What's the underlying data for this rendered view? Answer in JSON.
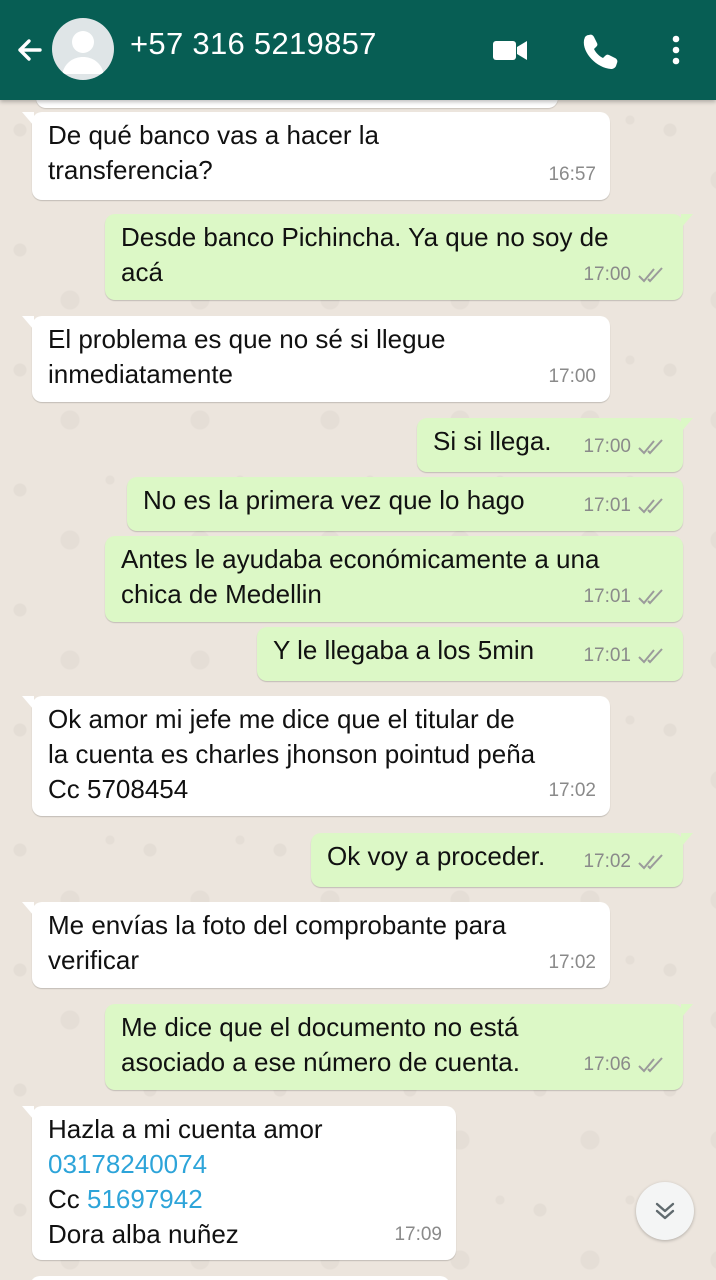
{
  "header": {
    "contact": "+57 316 5219857"
  },
  "messages": [
    {
      "dir": "in",
      "lines": [
        "De qué banco vas a hacer la",
        "transferencia?"
      ],
      "time": "16:57"
    },
    {
      "dir": "out",
      "lines": [
        "Desde banco Pichincha. Ya que no soy de",
        "acá"
      ],
      "time": "17:00"
    },
    {
      "dir": "in",
      "lines": [
        "El problema es que no sé si llegue",
        "inmediatamente"
      ],
      "time": "17:00"
    },
    {
      "dir": "out",
      "lines": [
        "Si si llega."
      ],
      "time": "17:00"
    },
    {
      "dir": "out",
      "lines": [
        "No es la primera vez que lo hago"
      ],
      "time": "17:01"
    },
    {
      "dir": "out",
      "lines": [
        "Antes le ayudaba económicamente a una",
        "chica de Medellin"
      ],
      "time": "17:01"
    },
    {
      "dir": "out",
      "lines": [
        "Y le llegaba a los 5min"
      ],
      "time": "17:01"
    },
    {
      "dir": "in",
      "lines": [
        "Ok amor mi jefe me dice que el titular de",
        "la cuenta es charles jhonson pointud peña",
        "Cc 5708454"
      ],
      "time": "17:02"
    },
    {
      "dir": "out",
      "lines": [
        "Ok voy a proceder."
      ],
      "time": "17:02"
    },
    {
      "dir": "in",
      "lines": [
        "Me envías la foto del comprobante para",
        "verificar"
      ],
      "time": "17:02"
    },
    {
      "dir": "out",
      "lines": [
        "Me dice que el documento no está",
        "asociado a ese número de cuenta."
      ],
      "time": "17:06"
    },
    {
      "dir": "in",
      "lines": [
        "Hazla a mi cuenta amor"
      ],
      "link1": "03178240074",
      "cc_prefix": "Cc ",
      "link2": "51697942",
      "last_line": "Dora alba nuñez",
      "time": "17:09"
    }
  ],
  "colors": {
    "header": "#075e54",
    "incoming": "#ffffff",
    "outgoing": "#dcf8c6",
    "link": "#2da4d9",
    "chat_bg": "#ece5dd"
  },
  "icons": [
    "back-arrow-icon",
    "avatar-placeholder-icon",
    "video-call-icon",
    "phone-icon",
    "more-options-icon",
    "double-check-icon",
    "scroll-down-icon"
  ]
}
